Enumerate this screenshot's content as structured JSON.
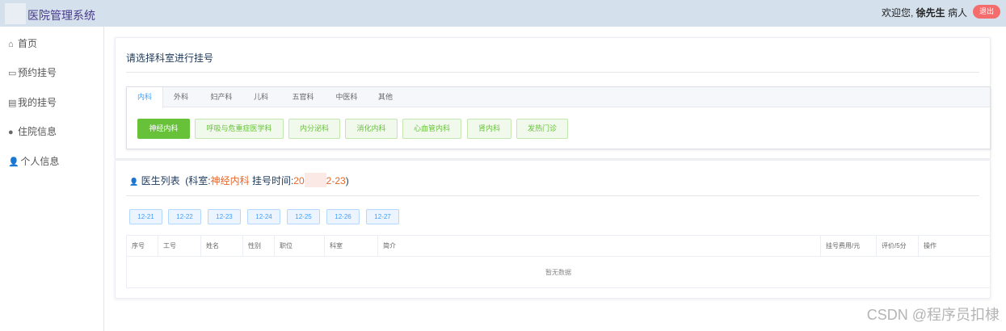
{
  "header": {
    "app_title": "医院管理系统",
    "welcome_prefix": "欢迎您,",
    "user_name": "徐先生",
    "user_role": "病人",
    "logout_label": "退出"
  },
  "sidebar": {
    "items": [
      {
        "label": "首页",
        "icon": "home-icon"
      },
      {
        "label": "预约挂号",
        "icon": "calendar-icon"
      },
      {
        "label": "我的挂号",
        "icon": "list-icon"
      },
      {
        "label": "住院信息",
        "icon": "bed-icon"
      },
      {
        "label": "个人信息",
        "icon": "user-icon"
      }
    ]
  },
  "dept_panel": {
    "title": "请选择科室进行挂号",
    "tabs": [
      "内科",
      "外科",
      "妇产科",
      "儿科",
      "五官科",
      "中医科",
      "其他"
    ],
    "departments": [
      "神经内科",
      "呼吸与危重症医学科",
      "内分泌科",
      "消化内科",
      "心血管内科",
      "肾内科",
      "发热门诊"
    ]
  },
  "doctor_panel": {
    "title": "医生列表",
    "dept_label": "(科室:",
    "dept_value": "神经内科",
    "time_label": "挂号时间:",
    "date_prefix": "20",
    "date_suffix": "2-23",
    "close_paren": ")",
    "dates": [
      "12-21",
      "12-22",
      "12-23",
      "12-24",
      "12-25",
      "12-26",
      "12-27"
    ],
    "columns": [
      "序号",
      "工号",
      "姓名",
      "性别",
      "职位",
      "科室",
      "简介",
      "挂号费用/元",
      "评价/5分",
      "操作"
    ],
    "empty_text": "暂无数据"
  },
  "watermark": "CSDN @程序员扣棣",
  "colors": {
    "topbar": "#d4e0ec",
    "accent_green": "#67c23a",
    "accent_blue": "#409eff",
    "accent_orange": "#e6662a",
    "logout_red": "#f56c6c"
  }
}
